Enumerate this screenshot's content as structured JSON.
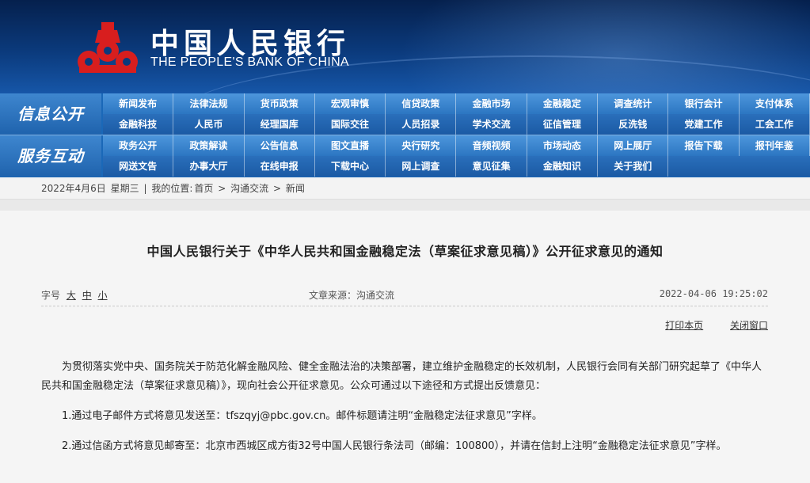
{
  "header": {
    "brand_cn": "中国人民银行",
    "brand_en": "THE PEOPLE'S BANK OF CHINA",
    "logo_icon": "pboc-logo-icon",
    "colors": {
      "header_top": "#05204d",
      "header_bottom": "#1656a8",
      "logo_red": "#d81e1e"
    }
  },
  "nav": {
    "section1": {
      "label": "信息公开",
      "row1": [
        "新闻发布",
        "法律法规",
        "货币政策",
        "宏观审慎",
        "信贷政策",
        "金融市场",
        "金融稳定",
        "调查统计",
        "银行会计",
        "支付体系"
      ],
      "row2": [
        "金融科技",
        "人民币",
        "经理国库",
        "国际交往",
        "人员招录",
        "学术交流",
        "征信管理",
        "反洗钱",
        "党建工作",
        "工会工作"
      ]
    },
    "section2": {
      "label": "服务互动",
      "row1": [
        "政务公开",
        "政策解读",
        "公告信息",
        "图文直播",
        "央行研究",
        "音频视频",
        "市场动态",
        "网上展厅",
        "报告下载",
        "报刊年鉴"
      ],
      "row2": [
        "网送文告",
        "办事大厅",
        "在线申报",
        "下载中心",
        "网上调查",
        "意见征集",
        "金融知识",
        "关于我们"
      ]
    }
  },
  "breadcrumb": {
    "date": "2022年4月6日",
    "weekday": "星期三",
    "sep": "|",
    "location_label": "我的位置:",
    "home": "首页",
    "arrow1": ">",
    "level1": "沟通交流",
    "arrow2": ">",
    "level2": "新闻"
  },
  "article": {
    "title": "中国人民银行关于《中华人民共和国金融稳定法（草案征求意见稿）》公开征求意见的通知",
    "font_size_label": "字号",
    "font_large": "大",
    "font_medium": "中",
    "font_small": "小",
    "source": "文章来源：沟通交流",
    "datetime": "2022-04-06 19:25:02",
    "print_label": "打印本页",
    "close_label": "关闭窗口",
    "paragraphs": [
      "为贯彻落实党中央、国务院关于防范化解金融风险、健全金融法治的决策部署，建立维护金融稳定的长效机制，人民银行会同有关部门研究起草了《中华人民共和国金融稳定法（草案征求意见稿）》，现向社会公开征求意见。公众可通过以下途径和方式提出反馈意见：",
      "1.通过电子邮件方式将意见发送至：tfszqyj@pbc.gov.cn。邮件标题请注明“金融稳定法征求意见”字样。",
      "2.通过信函方式将意见邮寄至：北京市西城区成方街32号中国人民银行条法司（邮编：100800），并请在信封上注明“金融稳定法征求意见”字样。"
    ]
  }
}
